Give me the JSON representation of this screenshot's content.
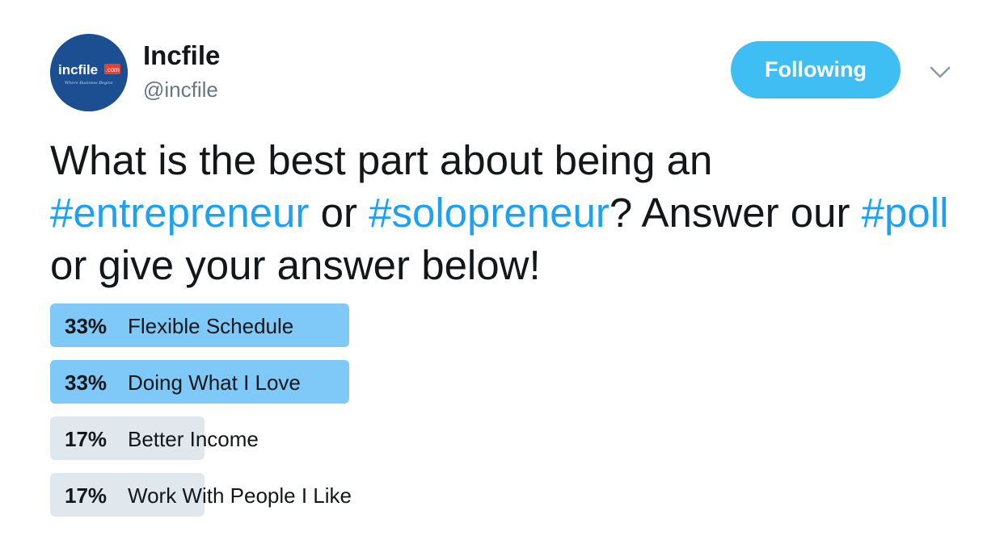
{
  "author": {
    "name": "Incfile",
    "handle": "@incfile",
    "avatar": {
      "logo_text": "incfile",
      "logo_badge": ".com",
      "tagline": "Where Business Begins",
      "background": "#1b4f91"
    }
  },
  "follow_button": {
    "label": "Following",
    "color": "#3fbef4"
  },
  "menu_icon": "chevron-down-icon",
  "tweet": {
    "segments": [
      {
        "text": "What is the best part about being an ",
        "hashtag": false
      },
      {
        "text": "#entrepreneur",
        "hashtag": true
      },
      {
        "text": " or ",
        "hashtag": false
      },
      {
        "text": "#solopreneur",
        "hashtag": true
      },
      {
        "text": "? Answer our ",
        "hashtag": false
      },
      {
        "text": "#poll",
        "hashtag": true
      },
      {
        "text": " or give your answer below!",
        "hashtag": false
      }
    ],
    "hashtag_color": "#1da1f2"
  },
  "poll": {
    "options": [
      {
        "percent": "33%",
        "value": 33,
        "label": "Flexible Schedule",
        "leading": true
      },
      {
        "percent": "33%",
        "value": 33,
        "label": "Doing What I Love",
        "leading": true
      },
      {
        "percent": "17%",
        "value": 17,
        "label": "Better Income",
        "leading": false
      },
      {
        "percent": "17%",
        "value": 17,
        "label": "Work With People I Like",
        "leading": false
      }
    ],
    "leading_color": "#7ec9f7",
    "trailing_color": "#e1e8ed"
  }
}
